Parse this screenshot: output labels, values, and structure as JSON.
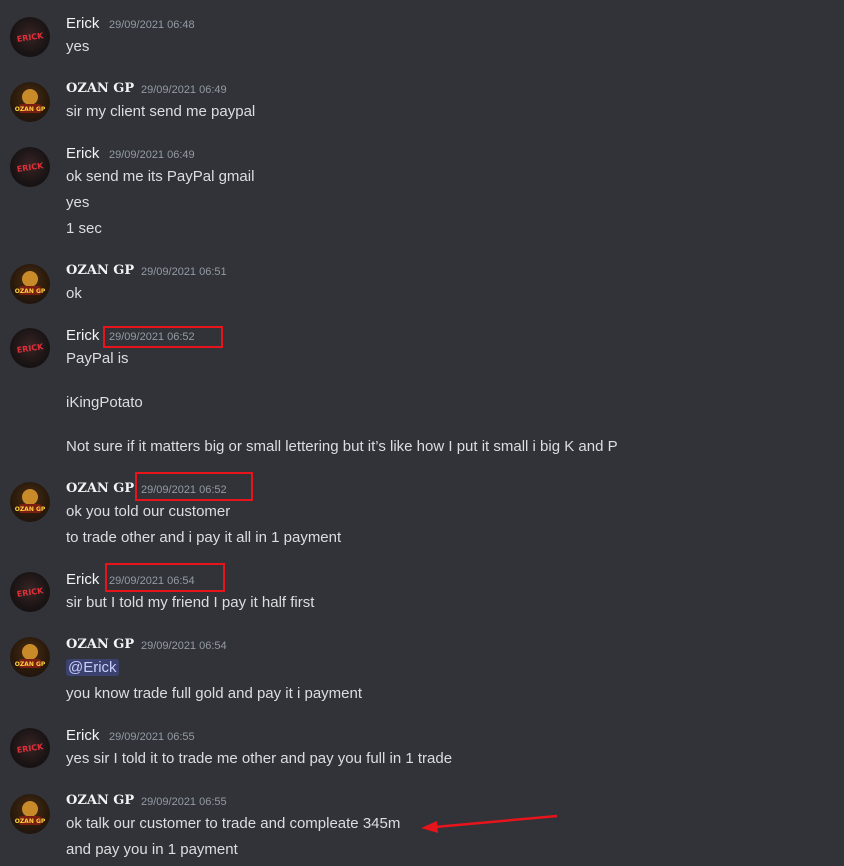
{
  "messages": [
    {
      "author": "Erick",
      "timestamp": "29/09/2021 06:48",
      "lines": [
        "yes"
      ]
    },
    {
      "author": "OZAN GP",
      "timestamp": "29/09/2021 06:49",
      "lines": [
        "sir my client send me paypal"
      ]
    },
    {
      "author": "Erick",
      "timestamp": "29/09/2021 06:49",
      "lines": [
        "ok send me its PayPal gmail",
        "yes",
        "1 sec"
      ]
    },
    {
      "author": "OZAN GP",
      "timestamp": "29/09/2021 06:51",
      "lines": [
        "ok"
      ]
    },
    {
      "author": "Erick",
      "timestamp": "29/09/2021 06:52",
      "lines": [
        "PayPal is",
        "iKingPotato",
        "Not sure if it matters big or small lettering but it’s like how I put it small i big K and P"
      ]
    },
    {
      "author": "OZAN GP",
      "timestamp": "29/09/2021 06:52",
      "lines": [
        "ok you told our customer",
        "to trade other and i pay it all in 1 payment"
      ]
    },
    {
      "author": "Erick",
      "timestamp": "29/09/2021 06:54",
      "lines": [
        "sir but I told my friend I pay it half first"
      ]
    },
    {
      "author": "OZAN GP",
      "timestamp": "29/09/2021 06:54",
      "mention": "@Erick",
      "lines": [
        "you know trade full gold and pay it i payment"
      ]
    },
    {
      "author": "Erick",
      "timestamp": "29/09/2021 06:55",
      "lines": [
        "yes sir I told it to trade me other and pay you full in 1 trade"
      ]
    },
    {
      "author": "OZAN GP",
      "timestamp": "29/09/2021 06:55",
      "lines": [
        "ok talk our customer to trade and compleate 345m",
        "and pay you in 1 payment"
      ]
    }
  ],
  "avatars": {
    "erick_text": "ERICK",
    "ozan_text": "OZAN GP"
  },
  "colors": {
    "background": "#313338",
    "annotation_red": "#e8141c",
    "mention_bg": "#3c4270"
  }
}
